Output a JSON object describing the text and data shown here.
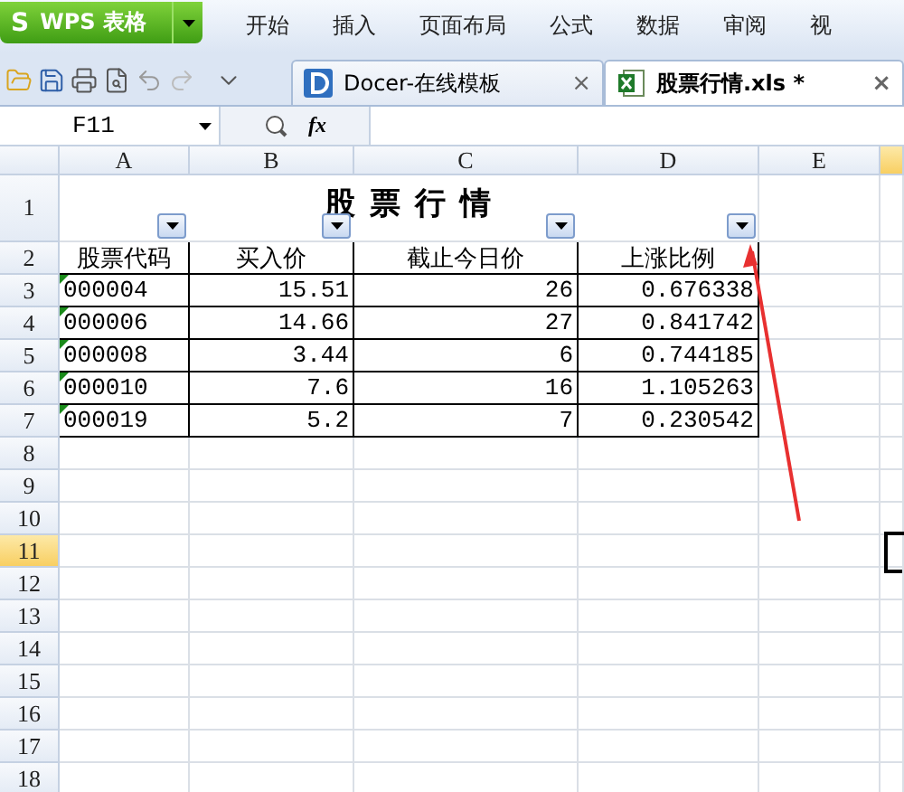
{
  "app_button": {
    "logo": "S",
    "label": "WPS 表格"
  },
  "menu": [
    "开始",
    "插入",
    "页面布局",
    "公式",
    "数据",
    "审阅",
    "视"
  ],
  "doc_tabs": [
    {
      "kind": "docer",
      "label": "Docer-在线模板",
      "close": "×",
      "selected": false
    },
    {
      "kind": "sheet",
      "label": "股票行情.xls *",
      "close": "×",
      "selected": true
    }
  ],
  "formula_bar": {
    "name_box": "F11",
    "fx": "fx"
  },
  "columns": [
    {
      "label": "A",
      "filter": true,
      "selected": false
    },
    {
      "label": "B",
      "filter": true,
      "selected": false
    },
    {
      "label": "C",
      "filter": true,
      "selected": false
    },
    {
      "label": "D",
      "filter": true,
      "selected": false
    },
    {
      "label": "E",
      "filter": false,
      "selected": false
    }
  ],
  "partial_column": {
    "selected": true
  },
  "sheet_title": "股 票 行 情",
  "header_row": [
    "股票代码",
    "买入价",
    "截止今日价",
    "上涨比例"
  ],
  "data_rows": [
    {
      "cells": [
        "000004",
        "15.51",
        "26",
        "0.676338"
      ],
      "text_flag": true
    },
    {
      "cells": [
        "000006",
        "14.66",
        "27",
        "0.841742"
      ],
      "text_flag": true
    },
    {
      "cells": [
        "000008",
        "3.44",
        "6",
        "0.744185"
      ],
      "text_flag": true
    },
    {
      "cells": [
        "000010",
        "7.6",
        "16",
        "1.105263"
      ],
      "text_flag": true
    },
    {
      "cells": [
        "000019",
        "5.2",
        "7",
        "0.230542"
      ],
      "text_flag": true
    }
  ],
  "row_numbers": [
    {
      "label": "1",
      "selected": false
    },
    {
      "label": "2",
      "selected": false
    },
    {
      "label": "3",
      "selected": false
    },
    {
      "label": "4",
      "selected": false
    },
    {
      "label": "5",
      "selected": false
    },
    {
      "label": "6",
      "selected": false
    },
    {
      "label": "7",
      "selected": false
    },
    {
      "label": "8",
      "selected": false
    },
    {
      "label": "9",
      "selected": false
    },
    {
      "label": "10",
      "selected": false
    },
    {
      "label": "11",
      "selected": true
    },
    {
      "label": "12",
      "selected": false
    },
    {
      "label": "13",
      "selected": false
    },
    {
      "label": "14",
      "selected": false
    },
    {
      "label": "15",
      "selected": false
    },
    {
      "label": "16",
      "selected": false
    },
    {
      "label": "17",
      "selected": false
    },
    {
      "label": "18",
      "selected": false
    }
  ]
}
